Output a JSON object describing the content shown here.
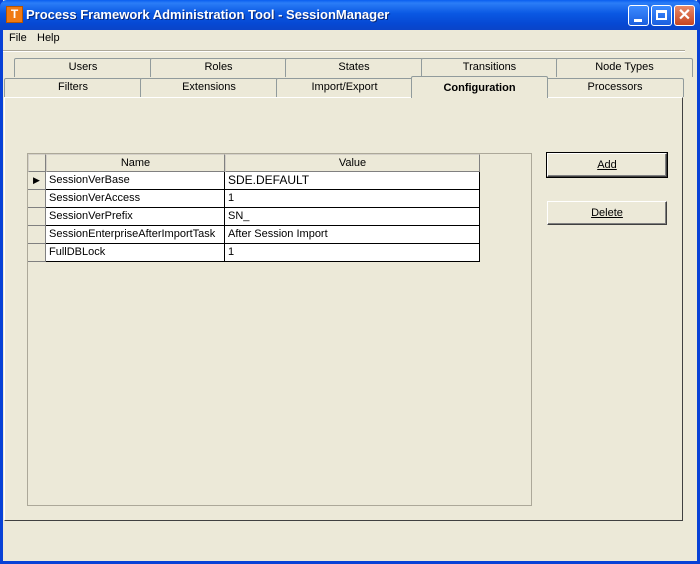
{
  "window": {
    "title": "Process Framework Administration Tool - SessionManager",
    "icon_letter": "T",
    "title_color": "#ffffff"
  },
  "titlebar_buttons": {
    "minimize": "minimize-icon",
    "maximize": "maximize-icon",
    "close": "close-icon",
    "close_glyph": "✕"
  },
  "menu": {
    "items": [
      "File",
      "Help"
    ]
  },
  "tabs": {
    "row1": [
      "Users",
      "Roles",
      "States",
      "Transitions",
      "Node Types"
    ],
    "row2": [
      "Filters",
      "Extensions",
      "Import/Export",
      "Configuration",
      "Processors"
    ],
    "active": "Configuration"
  },
  "grid": {
    "columns": [
      "Name",
      "Value"
    ],
    "current_row_marker": "▶",
    "rows": [
      {
        "name": "SessionVerBase",
        "value": "SDE.DEFAULT"
      },
      {
        "name": "SessionVerAccess",
        "value": "1"
      },
      {
        "name": "SessionVerPrefix",
        "value": "SN_"
      },
      {
        "name": "SessionEnterpriseAfterImportTask",
        "value": "After Session Import"
      },
      {
        "name": "FullDBLock",
        "value": "1"
      }
    ]
  },
  "buttons": {
    "add": "Add",
    "delete": "Delete"
  },
  "colors": {
    "titlebar": "#0a5ef0",
    "window_bg": "#ece9d8",
    "close_button": "#c6451f"
  }
}
